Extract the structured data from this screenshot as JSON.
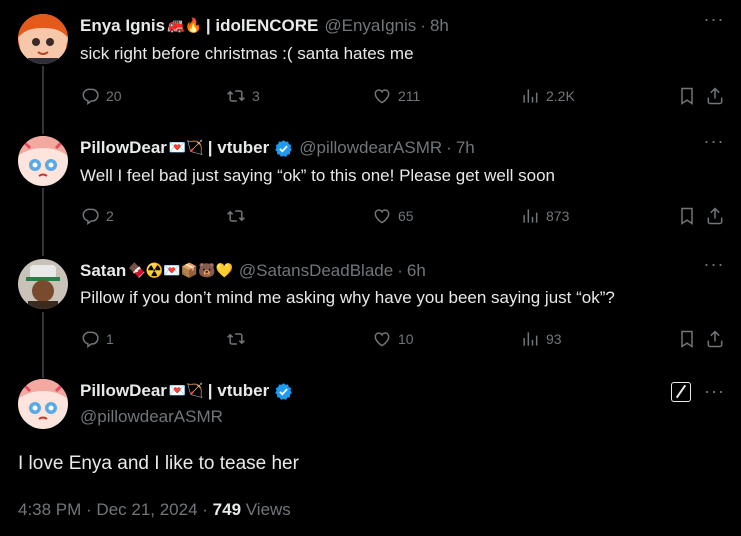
{
  "replies": [
    {
      "name": "Enya Ignis",
      "emoji": "🚒🔥",
      "suffix": "| idolENCORE",
      "handle": "@EnyaIgnis",
      "time": "8h",
      "text": "sick right before christmas :( santa hates me",
      "reply_count": "20",
      "retweet_count": "3",
      "like_count": "211",
      "view_count": "2.2K"
    },
    {
      "name": "PillowDear",
      "emoji": "💌🏹",
      "suffix": "| vtuber",
      "handle": "@pillowdearASMR",
      "time": "7h",
      "text": "Well I feel bad just saying “ok” to this one! Please get well soon",
      "reply_count": "2",
      "retweet_count": "",
      "like_count": "65",
      "view_count": "873"
    },
    {
      "name": "Satan",
      "emoji": "🍫☢️💌📦🐻💛",
      "suffix": "",
      "handle": "@SatansDeadBlade",
      "time": "6h",
      "text": "Pillow if you don’t mind me asking why have you been saying just “ok”?",
      "reply_count": "1",
      "retweet_count": "",
      "like_count": "10",
      "view_count": "93"
    }
  ],
  "main": {
    "name": "PillowDear",
    "emoji": "💌🏹",
    "suffix": "| vtuber",
    "handle": "@pillowdearASMR",
    "text": "I love Enya and I like to tease her",
    "timestamp": "4:38 PM · Dec 21, 2024 · ",
    "views": "749",
    "views_label": "Views"
  },
  "icons": {
    "more": "more-icon",
    "reply": "reply-icon",
    "retweet": "retweet-icon",
    "like": "like-icon",
    "views": "views-icon",
    "bookmark": "bookmark-icon",
    "share": "share-icon",
    "verified": "verified-icon",
    "edit": "edit-icon"
  },
  "colors": {
    "background": "#000000",
    "text": "#e7e9ea",
    "muted": "#71767b",
    "verified": "#1d9bf0",
    "line": "#333639"
  }
}
